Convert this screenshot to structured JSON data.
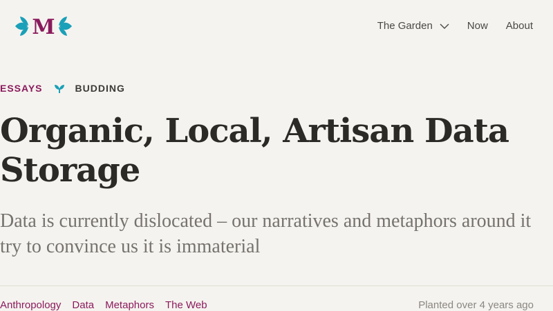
{
  "header": {
    "logo_letter": "M",
    "nav": [
      {
        "label": "The Garden",
        "icon": "chevron-down-icon"
      },
      {
        "label": "Now"
      },
      {
        "label": "About"
      }
    ]
  },
  "article": {
    "category": "ESSAYS",
    "growth_icon": "sprout-icon",
    "stage": "BUDDING",
    "title": "Organic, Local, Artisan Data Storage",
    "subtitle": "Data is currently dislocated – our narratives and metaphors around it try to convince us it is immaterial",
    "tags": [
      "Anthropology",
      "Data",
      "Metaphors",
      "The Web"
    ],
    "planted": "Planted over 4 years ago"
  },
  "colors": {
    "background": "#f5f3ef",
    "accent_teal": "#1aa0b8",
    "accent_plum": "#8a1a5c",
    "text": "#2b2a27"
  }
}
